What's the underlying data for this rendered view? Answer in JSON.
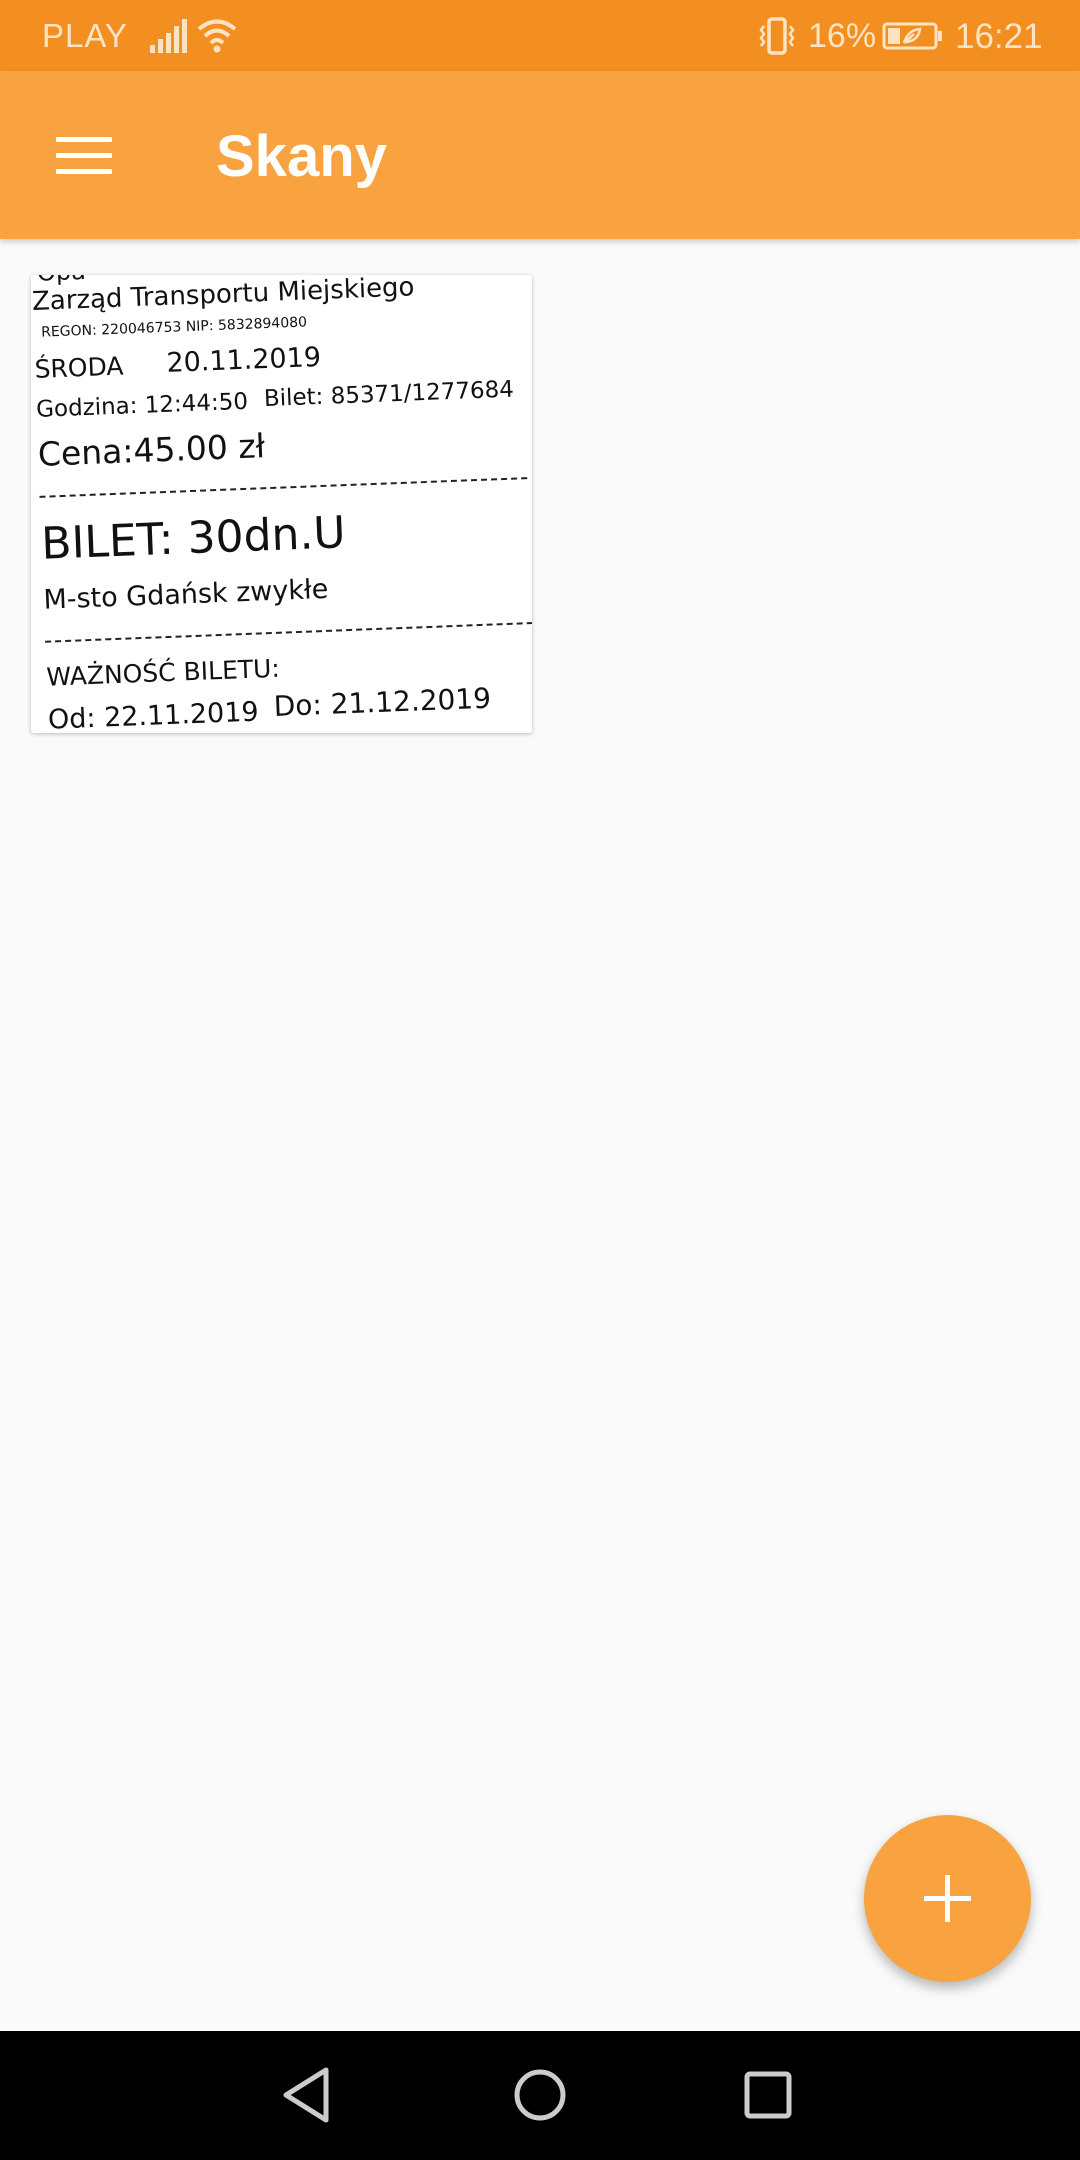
{
  "status_bar": {
    "carrier": "PLAY",
    "battery_percent": "16%",
    "time": "16:21",
    "icons": [
      "signal-icon",
      "wifi-icon",
      "vibrate-icon",
      "battery-saver-icon"
    ]
  },
  "app_bar": {
    "title": "Skany",
    "menu_icon": "hamburger-menu-icon"
  },
  "scans": [
    {
      "thumbnail_lines": {
        "header_partial": "Opa",
        "company": "Zarząd Transportu Miejskiego",
        "ids": "REGON: 220046753  NIP: 5832894080",
        "weekday": "ŚRODA",
        "date": "20.11.2019",
        "time_label": "Godzina: 12:44:50",
        "ticket_no": "Bilet: 85371/1277684",
        "price": "Cena:45.00 zł",
        "ticket_type": "BILET: 30dn.U",
        "zone": "M-sto Gdańsk zwykłe",
        "validity_label": "WAŻNOŚĆ BILETU:",
        "valid_from": "Od: 22.11.2019",
        "valid_to": "Do: 21.12.2019"
      }
    }
  ],
  "fab": {
    "icon": "plus-icon"
  },
  "nav_bar": {
    "icons": [
      "back-icon",
      "home-icon",
      "recents-icon"
    ]
  },
  "colors": {
    "status_bar": "#f28f20",
    "app_bar": "#f8a340",
    "fab": "#f8a340",
    "background": "#fafafa",
    "nav_bar": "#000000"
  }
}
